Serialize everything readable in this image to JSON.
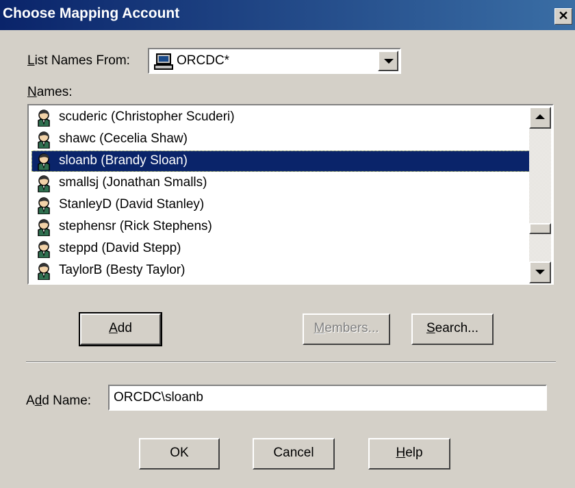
{
  "window": {
    "title": "Choose Mapping Account",
    "close_label": "✕"
  },
  "list_from": {
    "label_mnemonic": "L",
    "label_rest": "ist Names From:",
    "value": "ORCDC*"
  },
  "names": {
    "label_mnemonic": "N",
    "label_rest": "ames:",
    "items": [
      {
        "text": "scuderic (Christopher Scuderi)",
        "selected": false
      },
      {
        "text": "shawc (Cecelia Shaw)",
        "selected": false
      },
      {
        "text": "sloanb (Brandy Sloan)",
        "selected": true
      },
      {
        "text": "smallsj (Jonathan Smalls)",
        "selected": false
      },
      {
        "text": "StanleyD (David Stanley)",
        "selected": false
      },
      {
        "text": "stephensr (Rick Stephens)",
        "selected": false
      },
      {
        "text": "steppd (David Stepp)",
        "selected": false
      },
      {
        "text": "TaylorB (Besty Taylor)",
        "selected": false
      }
    ]
  },
  "buttons": {
    "add_mn": "A",
    "add_rest": "dd",
    "members_mn": "M",
    "members_rest": "embers...",
    "search_mn": "S",
    "search_rest": "earch...",
    "ok": "OK",
    "cancel": "Cancel",
    "help_mn": "H",
    "help_rest": "elp"
  },
  "add_name": {
    "label_pre": "A",
    "label_mn": "d",
    "label_rest": "d Name:",
    "value": "ORCDC\\sloanb"
  },
  "icons": {
    "domain": "computer-icon",
    "user": "user-icon"
  },
  "colors": {
    "selection": "#0a246a",
    "titlebar_start": "#0a246a",
    "titlebar_end": "#3a6ea5",
    "face": "#d4d0c8"
  }
}
